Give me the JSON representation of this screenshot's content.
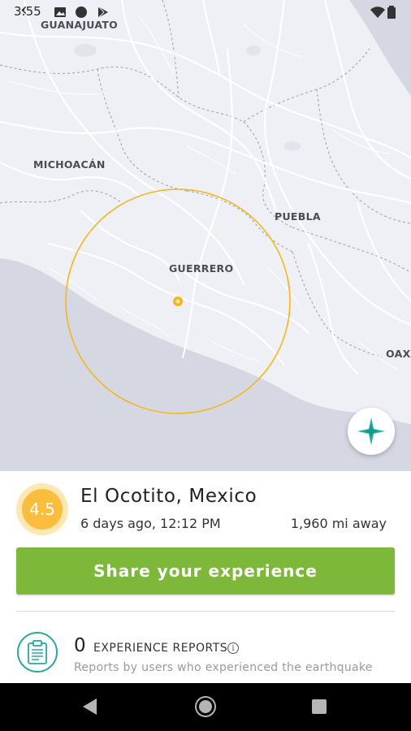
{
  "status_bar": {
    "time": "3:55",
    "icons": [
      "image-icon",
      "circle-icon",
      "play-store-icon",
      "wifi-icon",
      "battery-icon"
    ]
  },
  "map": {
    "labels": {
      "guanajuato": "GUANAJUATO",
      "michoacan": "MICHOACÁN",
      "puebla": "PUEBLA",
      "guerrero": "GUERRERO",
      "oaxaca": "OAXA"
    },
    "colors": {
      "land": "#eef0f5",
      "ocean": "#d5d8e3",
      "roads": "#ffffff",
      "impact_circle": "#f7b51c",
      "epicenter": "#f7b51c",
      "compass": "#20b2a3"
    },
    "compass_icon": "compass-star-icon"
  },
  "quake": {
    "magnitude": "4.5",
    "place": "El Ocotito, Mexico",
    "time_ago": "6 days ago, 12:12 PM",
    "distance": "1,960 mi away",
    "magnitude_color": "#fbbd3d"
  },
  "actions": {
    "share_label": "Share your experience",
    "share_color": "#7db83a"
  },
  "reports": {
    "count": "0",
    "label": "EXPERIENCE REPORTS",
    "info_symbol": "i",
    "subtitle": "Reports by users who experienced the earthquake",
    "icon": "clipboard-icon"
  },
  "navbar": {
    "icons": [
      "back-triangle-icon",
      "home-circle-icon",
      "recent-square-icon"
    ]
  }
}
